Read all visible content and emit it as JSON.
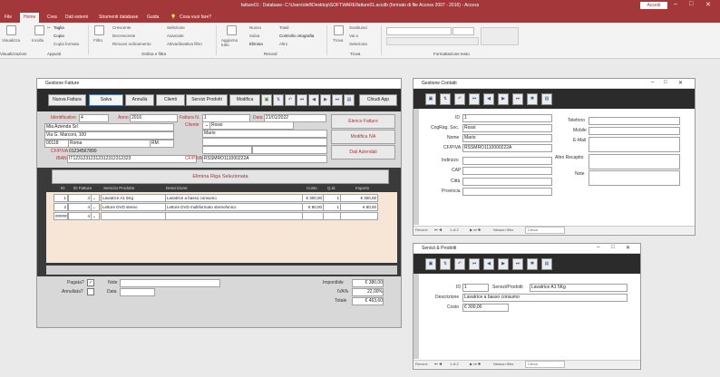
{
  "window": {
    "title": "fatture01 : Database- C:\\Users\\dell\\Desktop\\SOFTWARE\\fatture01.accdb (formato di file Access 2007 - 2016) - Access",
    "account": "Accedi"
  },
  "ribbon_tabs": [
    "File",
    "Home",
    "Crea",
    "Dati esterni",
    "Strumenti database",
    "Guida",
    "Cosa vuoi fare?"
  ],
  "ribbon": {
    "visualizza": "Visualizza",
    "incolla": "Incolla",
    "taglia": "Taglia",
    "copia": "Copia",
    "copia_formato": "Copia formato",
    "filtro": "Filtro",
    "crescente": "Crescente",
    "decrescente": "Decrescente",
    "rimuovi_ordinamento": "Rimuovi ordinamento",
    "selezione": "Selezione",
    "avanzate": "Avanzate",
    "attiva_filtro": "Attiva/disattiva filtro",
    "aggiorna": "Aggiorna tutto",
    "nuovo": "Nuovo",
    "salva": "Salva",
    "elimina": "Elimina",
    "totali": "Totali",
    "controllo_ortografia": "Controllo ortografia",
    "altro": "Altro",
    "trova": "Trova",
    "sostituisci": "Sostituisci",
    "vai_a": "Vai a",
    "seleziona": "Seleziona",
    "groups": {
      "visualizzazioni": "Visualizzazioni",
      "appunti": "Appunti",
      "ordina": "Ordina e filtra",
      "record": "Record",
      "trova": "Trova",
      "formattazione": "Formattazione testo"
    }
  },
  "fatture": {
    "title": "Gestione Fatture",
    "buttons": [
      "Nuova Fattura",
      "Salva",
      "Annulla",
      "Clienti",
      "Servizi Prodotti",
      "Modifica",
      "Chiudi App"
    ],
    "identificativo_label": "Identificativo",
    "identificativo": "4",
    "anno_label": "Anno",
    "anno": "2016",
    "fattura_label": "Fattura N.",
    "fattura_n": "1",
    "data_label": "Data",
    "data": "21/01/2022",
    "cliente_label": "Cliente",
    "cliente_nome": "Rossi",
    "cliente_cognome": "Mario",
    "azienda": "Mia Azienda Srl",
    "indirizzo": "Via G. Marconi, 100",
    "cap": "00118",
    "citta": "Roma",
    "prov": "RM",
    "cfpiva_label": "CF/PIVA",
    "cfpiva": "01234567890",
    "iban_label": "IBAN",
    "iban": "IT12312312312312312312323",
    "cliente_cfpiva_label": "CF/PIVA",
    "cliente_cfpiva": "RSSMRO111000222A",
    "side_buttons": [
      "Elenco Fatture",
      "Modifica IVA",
      "Dati Aziendali"
    ],
    "elimina_riga": "Elimina Riga Selezionata",
    "columns": [
      "ID",
      "ID Fattura",
      "Servizio Prodotto",
      "Descrizione",
      "Costo",
      "Q.tà",
      "Importo"
    ],
    "rows": [
      {
        "id": "1",
        "id_fattura": "4",
        "servizio": "Lavatrice A1 5Kg",
        "descrizione": "Lavatrice a basso consumo",
        "costo": "€ 300,00",
        "qta": "1",
        "importo": "€ 300,00"
      },
      {
        "id": "2",
        "id_fattura": "4",
        "servizio": "Lettore DVD stereo",
        "descrizione": "Lettore DVD multiformato stereofonico",
        "costo": "€ 80,00",
        "qta": "1",
        "importo": "€ 80,00"
      },
      {
        "id": "#######",
        "id_fattura": "4",
        "servizio": "",
        "descrizione": "",
        "costo": "",
        "qta": "",
        "importo": ""
      }
    ],
    "pagata_label": "Pagata?",
    "annullata_label": "Annullata?",
    "note_label": "Note",
    "data2_label": "Data",
    "imponibile_label": "Imponibile",
    "imponibile": "€ 380,00",
    "iva_label": "IVA%",
    "iva": "22,00%",
    "totale_label": "Totale",
    "totale": "€ 463,60"
  },
  "contatti": {
    "title": "Gestione Contatti",
    "labels": [
      "ID",
      "CogRag. Soc.",
      "Nome",
      "CF/PIVA",
      "Indirizzo",
      "CAP",
      "Città",
      "Provincia"
    ],
    "values": [
      "1",
      "Rossi",
      "Mario",
      "RSSMRO1110000222A",
      "",
      "",
      "",
      ""
    ],
    "right_labels": [
      "Telefono",
      "Mobile",
      "E-Mail",
      "Altro Recapito",
      "Note"
    ],
    "recnav": {
      "record": "Record:",
      "pos": "1 di 2",
      "filtro": "Nessun filtro",
      "cerca": "Cerca"
    }
  },
  "servizi": {
    "title": "Servizi & Prodotti",
    "id_label": "ID",
    "id": "1",
    "sp_label": "Servizi/Prodotti",
    "sp": "Lavatrice A1 5Kg",
    "desc_label": "Descrizione",
    "desc": "Lavatrice a basso consumo",
    "costo_label": "Costo",
    "costo": "€ 300,00",
    "recnav": {
      "record": "Record:",
      "pos": "1 di 2",
      "filtro": "Nessun filtro",
      "cerca": "Cerca"
    }
  }
}
